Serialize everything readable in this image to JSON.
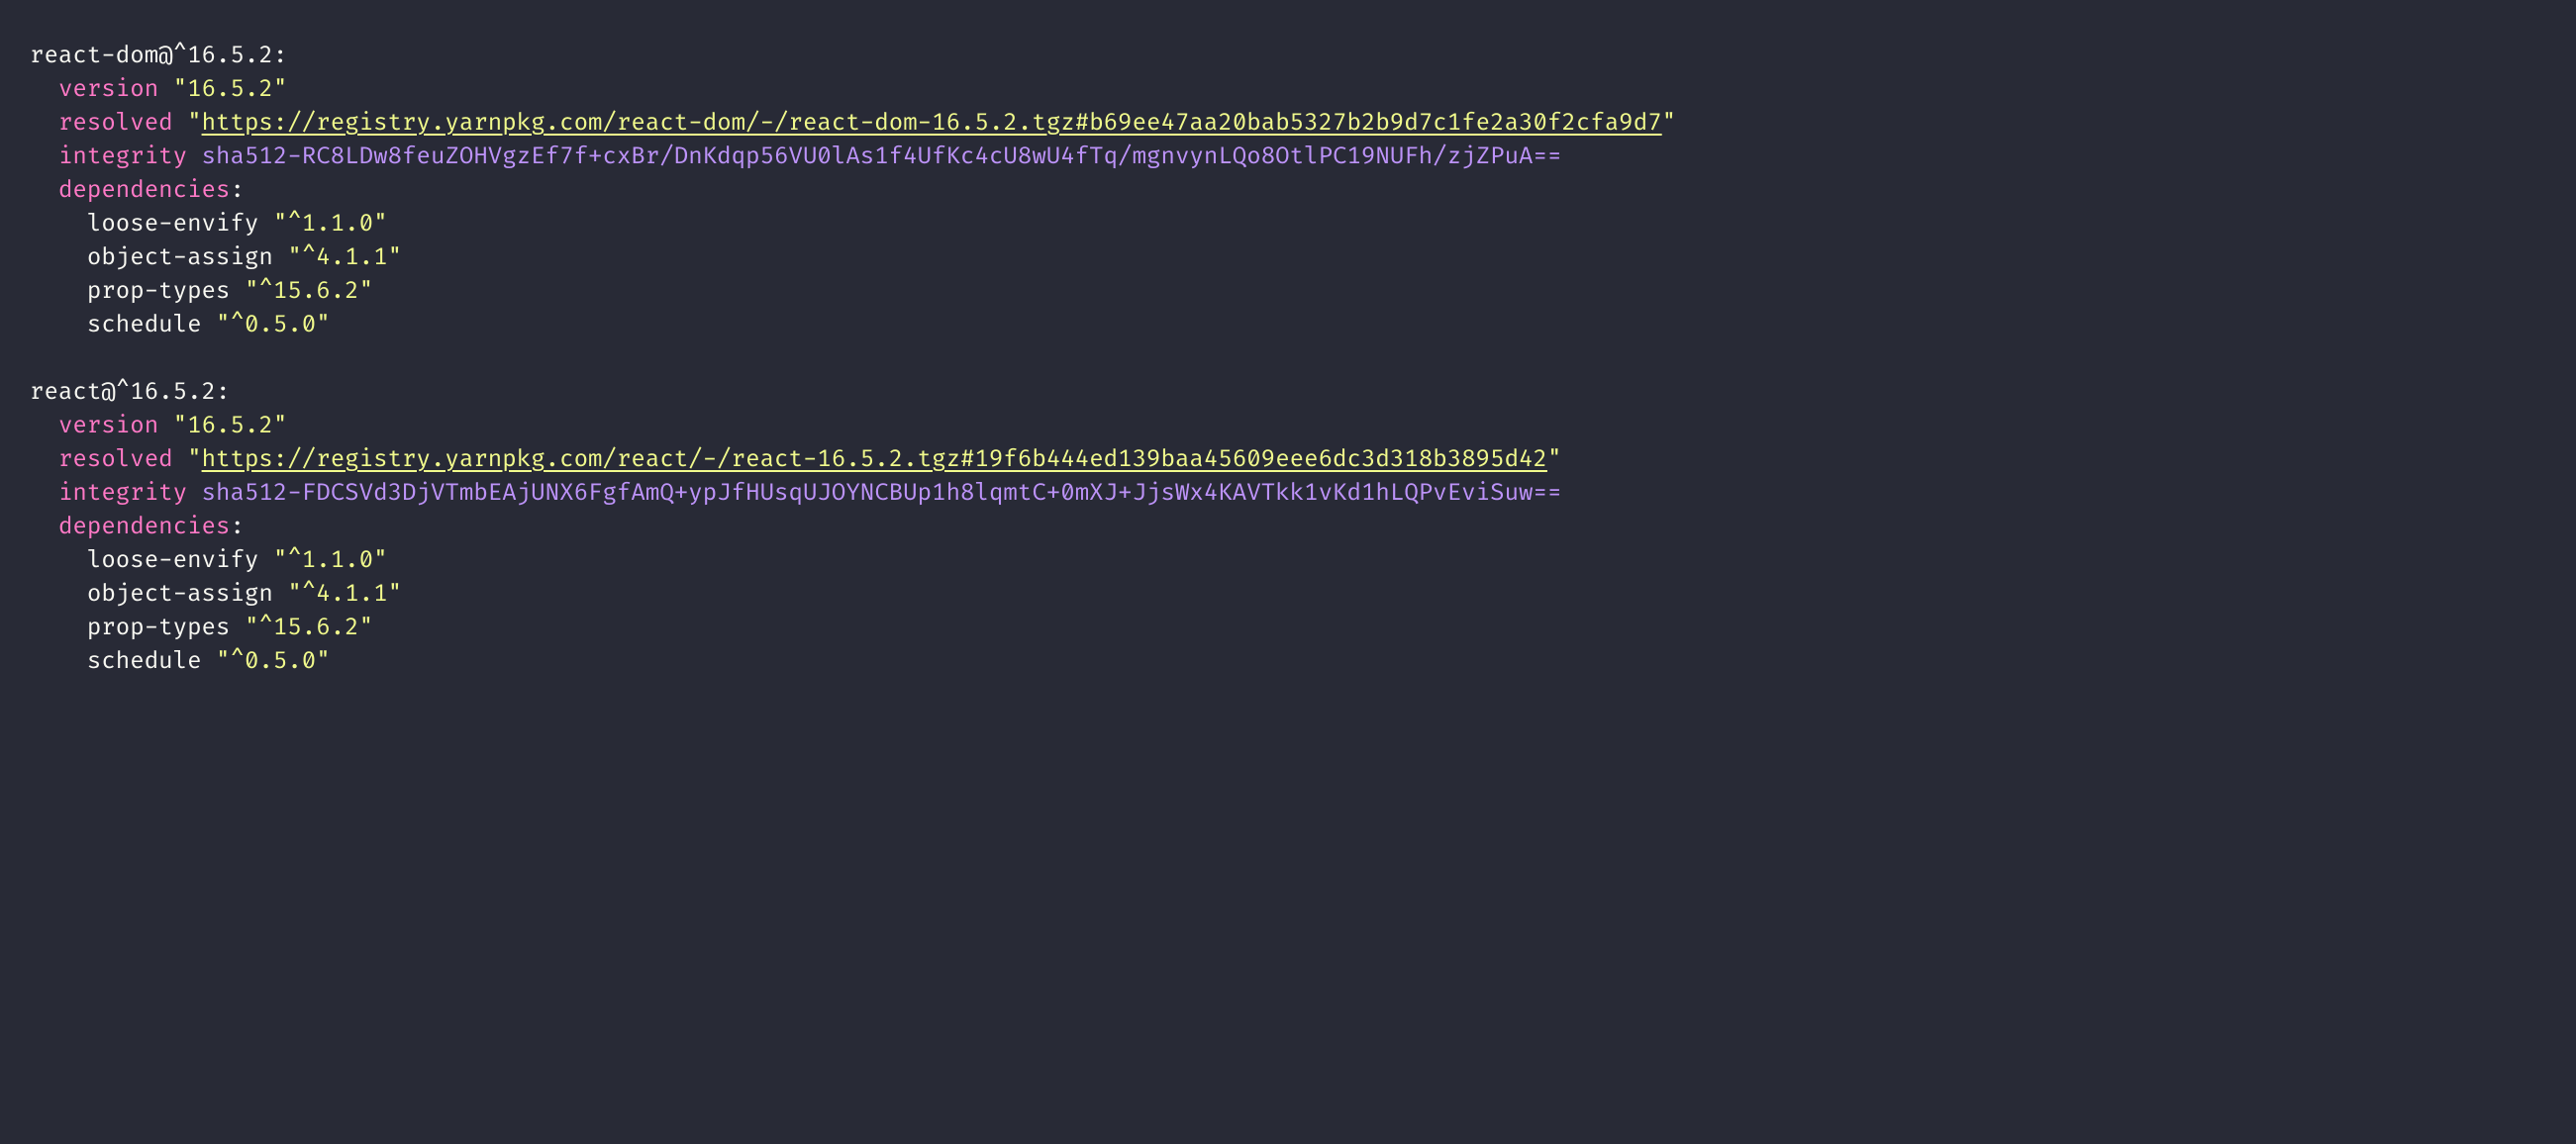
{
  "packages": [
    {
      "header": "react-dom@^16.5.2:",
      "version_key": "version",
      "version_val": "\"16.5.2\"",
      "resolved_key": "resolved",
      "resolved_q1": "\"",
      "resolved_url": "https://registry.yarnpkg.com/react-dom/-/react-dom-16.5.2.tgz#b69ee47aa20bab5327b2b9d7c1fe2a30f2cfa9d7",
      "resolved_q2": "\"",
      "integrity_key": "integrity",
      "integrity_val": "sha512-RC8LDw8feuZOHVgzEf7f+cxBr/DnKdqp56VU0lAs1f4UfKc4cU8wU4fTq/mgnvynLQo8OtlPC19NUFh/zjZPuA==",
      "dependencies_key": "dependencies",
      "deps": [
        {
          "name": "loose-envify",
          "ver": "\"^1.1.0\""
        },
        {
          "name": "object-assign",
          "ver": "\"^4.1.1\""
        },
        {
          "name": "prop-types",
          "ver": "\"^15.6.2\""
        },
        {
          "name": "schedule",
          "ver": "\"^0.5.0\""
        }
      ]
    },
    {
      "header": "react@^16.5.2:",
      "version_key": "version",
      "version_val": "\"16.5.2\"",
      "resolved_key": "resolved",
      "resolved_q1": "\"",
      "resolved_url": "https://registry.yarnpkg.com/react/-/react-16.5.2.tgz#19f6b444ed139baa45609eee6dc3d318b3895d42",
      "resolved_q2": "\"",
      "integrity_key": "integrity",
      "integrity_val": "sha512-FDCSVd3DjVTmbEAjUNX6FgfAmQ+ypJfHUsqUJOYNCBUp1h8lqmtC+0mXJ+JjsWx4KAVTkk1vKd1hLQPvEviSuw==",
      "dependencies_key": "dependencies",
      "deps": [
        {
          "name": "loose-envify",
          "ver": "\"^1.1.0\""
        },
        {
          "name": "object-assign",
          "ver": "\"^4.1.1\""
        },
        {
          "name": "prop-types",
          "ver": "\"^15.6.2\""
        },
        {
          "name": "schedule",
          "ver": "\"^0.5.0\""
        }
      ]
    }
  ]
}
